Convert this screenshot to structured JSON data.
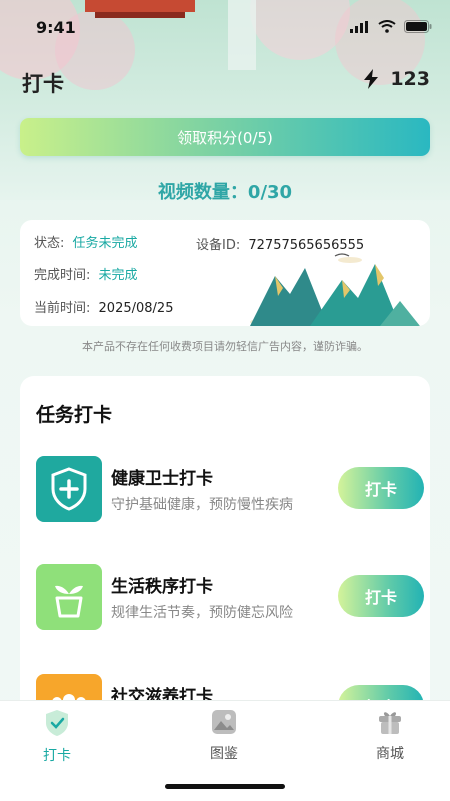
{
  "status_bar": {
    "time": "9:41"
  },
  "header": {
    "title": "打卡",
    "energy_value": "123"
  },
  "claim_button": {
    "label": "领取积分(0/5)"
  },
  "video_count": "视频数量：0/30",
  "info": {
    "status_label": "状态:",
    "status_value": "任务未完成",
    "device_label": "设备ID:",
    "device_value": "72757565656555",
    "complete_label": "完成时间:",
    "complete_value": "未完成",
    "current_label": "当前时间:",
    "current_value": "2025/08/25"
  },
  "disclaimer": "本产品不存在任何收费项目请勿轻信广告内容，谨防诈骗。",
  "tasks": {
    "title": "任务打卡",
    "items": [
      {
        "name": "健康卫士打卡",
        "desc": "守护基础健康，预防慢性疾病",
        "button": "打卡",
        "icon": "shield-plus-icon"
      },
      {
        "name": "生活秩序打卡",
        "desc": "规律生活节奏，预防健忘风险",
        "button": "打卡",
        "icon": "plant-pot-icon"
      },
      {
        "name": "社交滋养打卡",
        "desc": "",
        "button": "打卡",
        "icon": "people-icon"
      }
    ]
  },
  "tabbar": {
    "items": [
      {
        "label": "打卡",
        "icon": "checkin-shield-icon",
        "active": true
      },
      {
        "label": "图鉴",
        "icon": "picture-book-icon",
        "active": false
      },
      {
        "label": "商城",
        "icon": "gift-box-icon",
        "active": false
      }
    ]
  },
  "colors": {
    "accent": "#19a9a3",
    "text": "#222222",
    "muted": "#888888"
  }
}
